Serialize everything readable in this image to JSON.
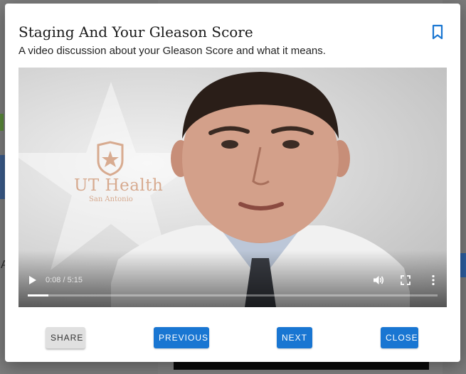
{
  "modal": {
    "title": "Staging And Your Gleason Score",
    "subtitle": "A video discussion about your Gleason Score and what it means.",
    "bookmark_icon": "bookmark-icon"
  },
  "video": {
    "logo_text": "UT Health",
    "logo_subtext": "San Antonio",
    "time_display": "0:08 / 5:15",
    "progress_fraction": 0.05,
    "icons": {
      "play": "play-icon",
      "volume": "volume-icon",
      "fullscreen": "fullscreen-icon",
      "more": "more-vert-icon"
    }
  },
  "footer": {
    "share_label": "SHARE",
    "previous_label": "PREVIOUS",
    "next_label": "NEXT",
    "close_label": "CLOSE"
  },
  "background": {
    "letter": "A"
  },
  "colors": {
    "accent": "#1976d2",
    "button_grey": "#e0e0e0",
    "modal_bg": "#ffffff"
  }
}
